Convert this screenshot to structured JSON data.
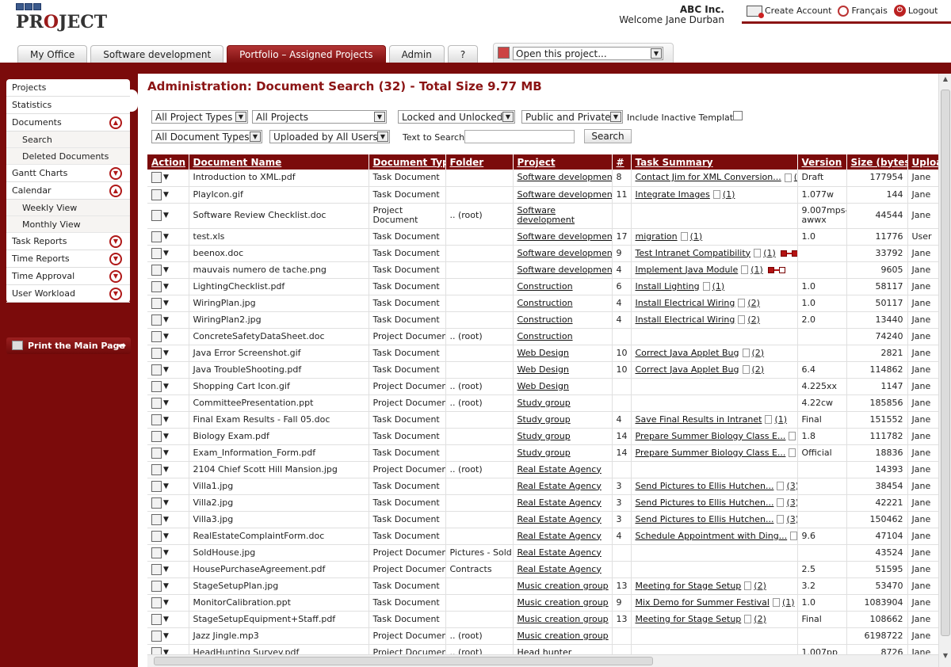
{
  "app": {
    "logo_text": "PROJECT",
    "company": "ABC Inc.",
    "welcome": "Welcome Jane Durban"
  },
  "toplinks": [
    {
      "label": "Create Account",
      "icon": "add-user-icon"
    },
    {
      "label": "Français",
      "icon": "language-icon"
    },
    {
      "label": "Logout",
      "icon": "power-icon"
    }
  ],
  "tabs": [
    "My Office",
    "Software development",
    "Portfolio – Assigned Projects",
    "Admin",
    "?"
  ],
  "open_project": {
    "value": "Open this project..."
  },
  "sidebar": {
    "items": [
      {
        "label": "Projects",
        "type": "item"
      },
      {
        "label": "Statistics",
        "type": "item"
      },
      {
        "label": "Documents",
        "type": "item",
        "toggle": "up"
      },
      {
        "label": "Search",
        "type": "sub"
      },
      {
        "label": "Deleted Documents",
        "type": "sub"
      },
      {
        "label": "Gantt Charts",
        "type": "item",
        "toggle": "down"
      },
      {
        "label": "Calendar",
        "type": "item",
        "toggle": "up"
      },
      {
        "label": "Weekly View",
        "type": "sub"
      },
      {
        "label": "Monthly View",
        "type": "sub"
      },
      {
        "label": "Task Reports",
        "type": "item",
        "toggle": "down"
      },
      {
        "label": "Time Reports",
        "type": "item",
        "toggle": "down"
      },
      {
        "label": "Time Approval",
        "type": "item",
        "toggle": "down"
      },
      {
        "label": "User Workload",
        "type": "item",
        "toggle": "down"
      }
    ],
    "print_label": "Print the Main Page"
  },
  "page": {
    "title": "Administration: Document Search (32) - Total Size 9.77 MB"
  },
  "filters": {
    "project_types": "All Project Types",
    "projects": "All Projects",
    "lock_state": "Locked and Unlocked",
    "visibility": "Public and Private",
    "include_inactive_label": "Include Inactive Templates",
    "doc_types": "All Document Types",
    "uploaded_by": "Uploaded by All Users",
    "text_search_label": "Text to Search:",
    "search_value": "",
    "search_button": "Search"
  },
  "table": {
    "headers": [
      "Action",
      "Document Name",
      "Document Type",
      "Folder",
      "Project",
      "#",
      "Task Summary",
      "Version",
      "Size (bytes)",
      "Uploa"
    ],
    "rows": [
      {
        "name": "Introduction to XML.pdf",
        "type": "Task Document",
        "folder": "",
        "project": "Software development",
        "num": "8",
        "task": "Contact Jim for XML Conversion...",
        "count": "(1)",
        "version": "Draft",
        "size": "177954",
        "uploader": "Jane",
        "dep": ""
      },
      {
        "name": "PlayIcon.gif",
        "type": "Task Document",
        "folder": "",
        "project": "Software development",
        "num": "11",
        "task": "Integrate Images",
        "count": "(1)",
        "version": "1.077w",
        "size": "144",
        "uploader": "Jane",
        "dep": ""
      },
      {
        "name": "Software Review Checklist.doc",
        "type": "Project Document",
        "folder": ".. (root)",
        "project": "Software development",
        "num": "",
        "task": "",
        "count": "",
        "version": "9.007mps-awwx",
        "size": "44544",
        "uploader": "Jane",
        "dep": "",
        "tall": true
      },
      {
        "name": "test.xls",
        "type": "Task Document",
        "folder": "",
        "project": "Software development",
        "num": "17",
        "task": "migration",
        "count": "(1)",
        "version": "1.0",
        "size": "11776",
        "uploader": "User",
        "dep": ""
      },
      {
        "name": "beenox.doc",
        "type": "Task Document",
        "folder": "",
        "project": "Software development",
        "num": "9",
        "task": "Test Intranet Compatibility",
        "count": "(1)",
        "version": "",
        "size": "33792",
        "uploader": "Jane",
        "dep": "a"
      },
      {
        "name": "mauvais numero de tache.png",
        "type": "Task Document",
        "folder": "",
        "project": "Software development",
        "num": "4",
        "task": "Implement Java Module",
        "count": "(1)",
        "version": "",
        "size": "9605",
        "uploader": "Jane",
        "dep": "b"
      },
      {
        "name": "LightingChecklist.pdf",
        "type": "Task Document",
        "folder": "",
        "project": "Construction",
        "num": "6",
        "task": "Install Lighting",
        "count": "(1)",
        "version": "1.0",
        "size": "58117",
        "uploader": "Jane",
        "dep": ""
      },
      {
        "name": "WiringPlan.jpg",
        "type": "Task Document",
        "folder": "",
        "project": "Construction",
        "num": "4",
        "task": "Install Electrical Wiring",
        "count": "(2)",
        "version": "1.0",
        "size": "50117",
        "uploader": "Jane",
        "dep": ""
      },
      {
        "name": "WiringPlan2.jpg",
        "type": "Task Document",
        "folder": "",
        "project": "Construction",
        "num": "4",
        "task": "Install Electrical Wiring",
        "count": "(2)",
        "version": "2.0",
        "size": "13440",
        "uploader": "Jane",
        "dep": ""
      },
      {
        "name": "ConcreteSafetyDataSheet.doc",
        "type": "Project Document",
        "folder": ".. (root)",
        "project": "Construction",
        "num": "",
        "task": "",
        "count": "",
        "version": "",
        "size": "74240",
        "uploader": "Jane",
        "dep": ""
      },
      {
        "name": "Java Error Screenshot.gif",
        "type": "Task Document",
        "folder": "",
        "project": "Web Design",
        "num": "10",
        "task": "Correct Java Applet Bug",
        "count": "(2)",
        "version": "",
        "size": "2821",
        "uploader": "Jane",
        "dep": ""
      },
      {
        "name": "Java TroubleShooting.pdf",
        "type": "Task Document",
        "folder": "",
        "project": "Web Design",
        "num": "10",
        "task": "Correct Java Applet Bug",
        "count": "(2)",
        "version": "6.4",
        "size": "114862",
        "uploader": "Jane",
        "dep": ""
      },
      {
        "name": "Shopping Cart Icon.gif",
        "type": "Project Document",
        "folder": ".. (root)",
        "project": "Web Design",
        "num": "",
        "task": "",
        "count": "",
        "version": "4.225xx",
        "size": "1147",
        "uploader": "Jane",
        "dep": ""
      },
      {
        "name": "CommitteePresentation.ppt",
        "type": "Project Document",
        "folder": ".. (root)",
        "project": "Study group",
        "num": "",
        "task": "",
        "count": "",
        "version": "4.22cw",
        "size": "185856",
        "uploader": "Jane",
        "dep": ""
      },
      {
        "name": "Final Exam Results - Fall 05.doc",
        "type": "Task Document",
        "folder": "",
        "project": "Study group",
        "num": "4",
        "task": "Save Final Results in Intranet",
        "count": "(1)",
        "version": "Final",
        "size": "151552",
        "uploader": "Jane",
        "dep": ""
      },
      {
        "name": "Biology Exam.pdf",
        "type": "Task Document",
        "folder": "",
        "project": "Study group",
        "num": "14",
        "task": "Prepare Summer Biology Class E...",
        "count": "(2)",
        "version": "1.8",
        "size": "111782",
        "uploader": "Jane",
        "dep": ""
      },
      {
        "name": "Exam_Information_Form.pdf",
        "type": "Task Document",
        "folder": "",
        "project": "Study group",
        "num": "14",
        "task": "Prepare Summer Biology Class E...",
        "count": "(2)",
        "version": "Official",
        "size": "18836",
        "uploader": "Jane",
        "dep": ""
      },
      {
        "name": "2104 Chief Scott Hill Mansion.jpg",
        "type": "Project Document",
        "folder": ".. (root)",
        "project": "Real Estate Agency",
        "num": "",
        "task": "",
        "count": "",
        "version": "",
        "size": "14393",
        "uploader": "Jane",
        "dep": ""
      },
      {
        "name": "Villa1.jpg",
        "type": "Task Document",
        "folder": "",
        "project": "Real Estate Agency",
        "num": "3",
        "task": "Send Pictures to Ellis Hutchen...",
        "count": "(3)",
        "version": "",
        "size": "38454",
        "uploader": "Jane",
        "dep": ""
      },
      {
        "name": "Villa2.jpg",
        "type": "Task Document",
        "folder": "",
        "project": "Real Estate Agency",
        "num": "3",
        "task": "Send Pictures to Ellis Hutchen...",
        "count": "(3)",
        "version": "",
        "size": "42221",
        "uploader": "Jane",
        "dep": ""
      },
      {
        "name": "Villa3.jpg",
        "type": "Task Document",
        "folder": "",
        "project": "Real Estate Agency",
        "num": "3",
        "task": "Send Pictures to Ellis Hutchen...",
        "count": "(3)",
        "version": "",
        "size": "150462",
        "uploader": "Jane",
        "dep": ""
      },
      {
        "name": "RealEstateComplaintForm.doc",
        "type": "Task Document",
        "folder": "",
        "project": "Real Estate Agency",
        "num": "4",
        "task": "Schedule Appointment with Ding...",
        "count": "(1)",
        "version": "9.6",
        "size": "47104",
        "uploader": "Jane",
        "dep": ""
      },
      {
        "name": "SoldHouse.jpg",
        "type": "Project Document",
        "folder": "Pictures - Sold",
        "project": "Real Estate Agency",
        "num": "",
        "task": "",
        "count": "",
        "version": "",
        "size": "43524",
        "uploader": "Jane",
        "dep": ""
      },
      {
        "name": "HousePurchaseAgreement.pdf",
        "type": "Project Document",
        "folder": "Contracts",
        "project": "Real Estate Agency",
        "num": "",
        "task": "",
        "count": "",
        "version": "2.5",
        "size": "51595",
        "uploader": "Jane",
        "dep": ""
      },
      {
        "name": "StageSetupPlan.jpg",
        "type": "Task Document",
        "folder": "",
        "project": "Music creation group",
        "num": "13",
        "task": "Meeting for Stage Setup",
        "count": "(2)",
        "version": "3.2",
        "size": "53470",
        "uploader": "Jane",
        "dep": ""
      },
      {
        "name": "MonitorCalibration.ppt",
        "type": "Task Document",
        "folder": "",
        "project": "Music creation group",
        "num": "9",
        "task": "Mix Demo for Summer Festival",
        "count": "(1)",
        "version": "1.0",
        "size": "1083904",
        "uploader": "Jane",
        "dep": ""
      },
      {
        "name": "StageSetupEquipment+Staff.pdf",
        "type": "Task Document",
        "folder": "",
        "project": "Music creation group",
        "num": "13",
        "task": "Meeting for Stage Setup",
        "count": "(2)",
        "version": "Final",
        "size": "108662",
        "uploader": "Jane",
        "dep": ""
      },
      {
        "name": "Jazz Jingle.mp3",
        "type": "Project Document",
        "folder": ".. (root)",
        "project": "Music creation group",
        "num": "",
        "task": "",
        "count": "",
        "version": "",
        "size": "6198722",
        "uploader": "Jane",
        "dep": ""
      },
      {
        "name": "HeadHunting Survey.pdf",
        "type": "Project Document",
        "folder": ".. (root)",
        "project": "Head hunter",
        "num": "",
        "task": "",
        "count": "",
        "version": "1.007pp",
        "size": "8726",
        "uploader": "Jane",
        "dep": ""
      }
    ]
  }
}
